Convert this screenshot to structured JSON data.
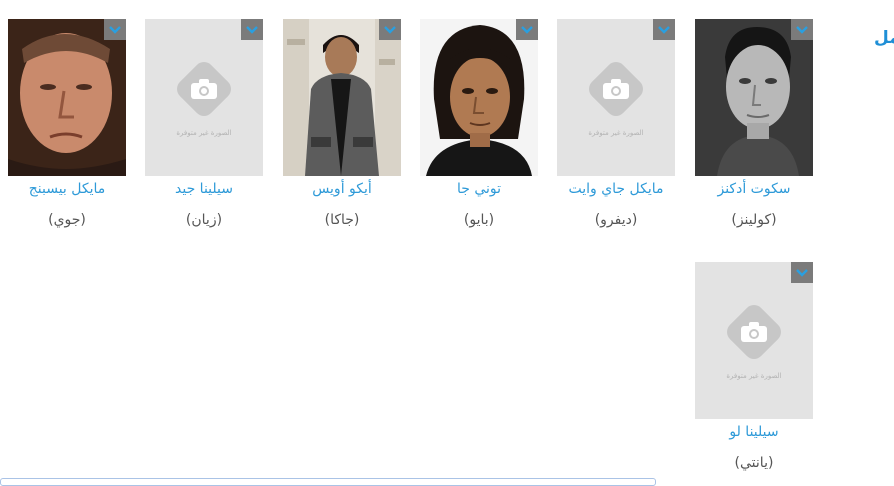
{
  "section": {
    "heading": "مل"
  },
  "placeholder_caption": "الصورة غير متوفرة",
  "colors": {
    "link": "#2e9ad8",
    "heading": "#1f8fd6",
    "menu_button": "#7b7b7b",
    "chevron": "#2a9fe0"
  },
  "cast": [
    {
      "name": "سكوت أدكنز",
      "role": "(كولينز)",
      "has_photo": true
    },
    {
      "name": "مايكل جاي وايت",
      "role": "(ديفرو)",
      "has_photo": false
    },
    {
      "name": "توني جا",
      "role": "(بايو)",
      "has_photo": true
    },
    {
      "name": "أيكو أويس",
      "role": "(جاكا)",
      "has_photo": true
    },
    {
      "name": "سيلينا جيد",
      "role": "(زيان)",
      "has_photo": false
    },
    {
      "name": "مايكل بيسبنج",
      "role": "(جوي)",
      "has_photo": true
    },
    {
      "name": "سيلينا لو",
      "role": "(يانتي)",
      "has_photo": false
    }
  ]
}
